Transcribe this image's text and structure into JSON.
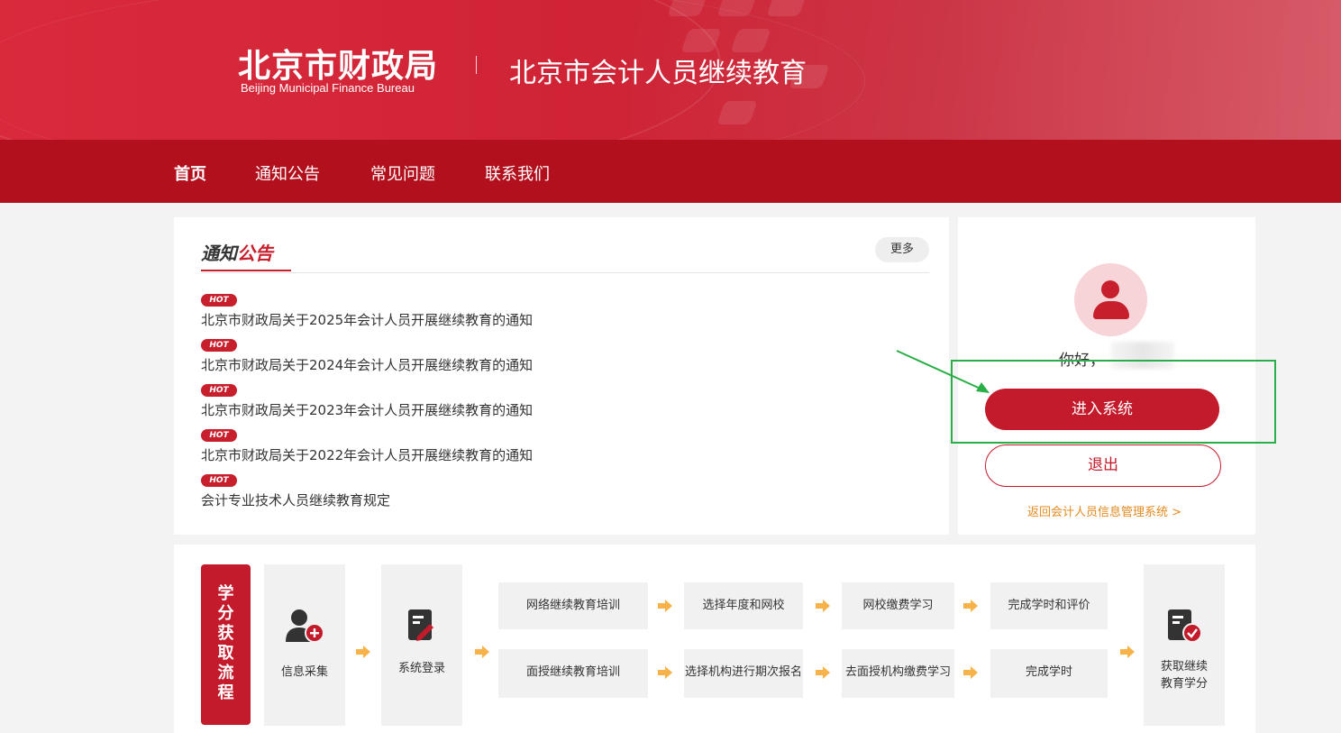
{
  "header": {
    "logo_cn": "北京市财政局",
    "logo_en": "Beijing Municipal Finance Bureau",
    "site_title": "北京市会计人员继续教育"
  },
  "nav": {
    "items": [
      {
        "label": "首页",
        "active": true
      },
      {
        "label": "通知公告",
        "active": false
      },
      {
        "label": "常见问题",
        "active": false
      },
      {
        "label": "联系我们",
        "active": false
      }
    ]
  },
  "notices": {
    "title_part1": "通知",
    "title_part2": "公告",
    "more_label": "更多",
    "badge": "HOT",
    "items": [
      "北京市财政局关于2025年会计人员开展继续教育的通知",
      "北京市财政局关于2024年会计人员开展继续教育的通知",
      "北京市财政局关于2023年会计人员开展继续教育的通知",
      "北京市财政局关于2022年会计人员开展继续教育的通知",
      "会计专业技术人员继续教育规定"
    ]
  },
  "user_panel": {
    "greeting": "你好，",
    "enter_label": "进入系统",
    "logout_label": "退出",
    "return_link": "返回会计人员信息管理系统 >"
  },
  "process": {
    "label_chars": [
      "学",
      "分",
      "获",
      "取",
      "流",
      "程"
    ],
    "step_info": "信息采集",
    "step_login": "系统登录",
    "row1": [
      "网络继续教育培训",
      "选择年度和网校",
      "网校缴费学习",
      "完成学时和评价"
    ],
    "row2": [
      "面授继续教育培训",
      "选择机构进行期次报名",
      "去面授机构缴费学习",
      "完成学时"
    ],
    "final_line1": "获取继续",
    "final_line2": "教育学分"
  },
  "colors": {
    "brand_red": "#c31b2b",
    "nav_red": "#b3101e",
    "hot_red": "#c81f2d",
    "link_orange": "#e38a1f",
    "annotation_green": "#2aae47",
    "chevron_orange": "#f7b24a"
  },
  "icons": [
    "user-add-icon",
    "login-form-icon",
    "certificate-check-icon",
    "avatar-user-icon",
    "chevron-right-icon"
  ]
}
